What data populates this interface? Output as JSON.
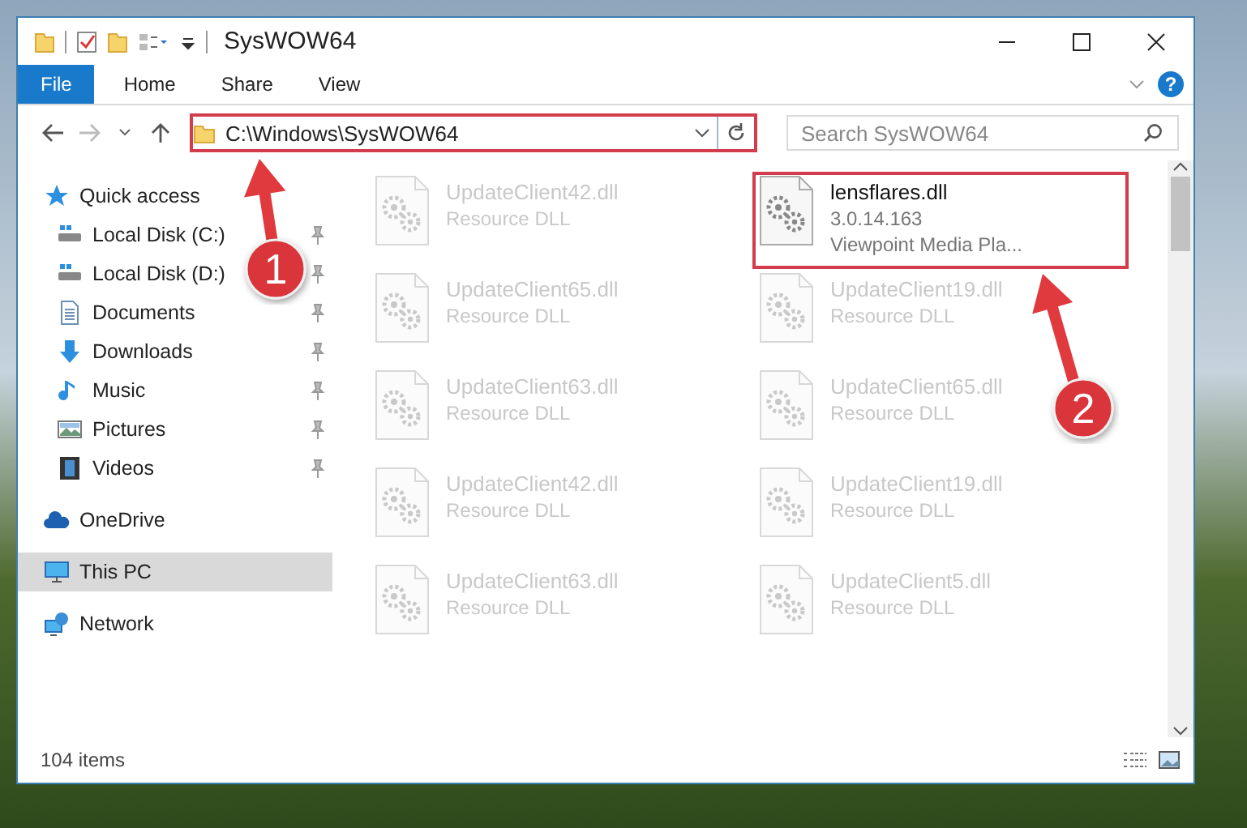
{
  "window": {
    "title": "SysWOW64"
  },
  "ribbon_tabs": [
    {
      "label": "File",
      "kind": "file"
    },
    {
      "label": "Home",
      "kind": "tab"
    },
    {
      "label": "Share",
      "kind": "tab"
    },
    {
      "label": "View",
      "kind": "tab"
    }
  ],
  "help_button": {
    "label": "?"
  },
  "address_bar": {
    "path": "C:\\Windows\\SysWOW64",
    "highlighted": true
  },
  "search": {
    "placeholder": "Search SysWOW64"
  },
  "sidebar": {
    "items": [
      {
        "label": "Quick access",
        "kind": "star",
        "selected": false,
        "pinned": false,
        "children": [
          {
            "label": "Local Disk (C:)",
            "kind": "drive",
            "selected": false,
            "pinned": true
          },
          {
            "label": "Local Disk (D:)",
            "kind": "drive",
            "selected": false,
            "pinned": true
          },
          {
            "label": "Documents",
            "kind": "document",
            "selected": false,
            "pinned": true
          },
          {
            "label": "Downloads",
            "kind": "download",
            "selected": false,
            "pinned": true
          },
          {
            "label": "Music",
            "kind": "music",
            "selected": false,
            "pinned": true
          },
          {
            "label": "Pictures",
            "kind": "picture",
            "selected": false,
            "pinned": true
          },
          {
            "label": "Videos",
            "kind": "video",
            "selected": false,
            "pinned": true
          }
        ]
      },
      {
        "label": "OneDrive",
        "kind": "cloud",
        "selected": false,
        "pinned": false
      },
      {
        "label": "This PC",
        "kind": "computer",
        "selected": true,
        "pinned": false
      },
      {
        "label": "Network",
        "kind": "network",
        "selected": false,
        "pinned": false
      }
    ]
  },
  "files": [
    {
      "name": "UpdateClient42.dll",
      "lines": [
        "Resource DLL"
      ],
      "blurred": true,
      "highlighted": false
    },
    {
      "name": "lensflares.dll",
      "lines": [
        "3.0.14.163",
        "Viewpoint Media Pla..."
      ],
      "blurred": false,
      "highlighted": true
    },
    {
      "name": "UpdateClient65.dll",
      "lines": [
        "Resource DLL"
      ],
      "blurred": true,
      "highlighted": false
    },
    {
      "name": "UpdateClient19.dll",
      "lines": [
        "Resource DLL"
      ],
      "blurred": true,
      "highlighted": false
    },
    {
      "name": "UpdateClient63.dll",
      "lines": [
        "Resource DLL"
      ],
      "blurred": true,
      "highlighted": false
    },
    {
      "name": "UpdateClient65.dll",
      "lines": [
        "Resource DLL"
      ],
      "blurred": true,
      "highlighted": false
    },
    {
      "name": "UpdateClient42.dll",
      "lines": [
        "Resource DLL"
      ],
      "blurred": true,
      "highlighted": false
    },
    {
      "name": "UpdateClient19.dll",
      "lines": [
        "Resource DLL"
      ],
      "blurred": true,
      "highlighted": false
    },
    {
      "name": "UpdateClient63.dll",
      "lines": [
        "Resource DLL"
      ],
      "blurred": true,
      "highlighted": false
    },
    {
      "name": "UpdateClient5.dll",
      "lines": [
        "Resource DLL"
      ],
      "blurred": true,
      "highlighted": false
    }
  ],
  "status_bar": {
    "item_count": "104 items"
  },
  "annotations": [
    {
      "number": "1"
    },
    {
      "number": "2"
    }
  ]
}
